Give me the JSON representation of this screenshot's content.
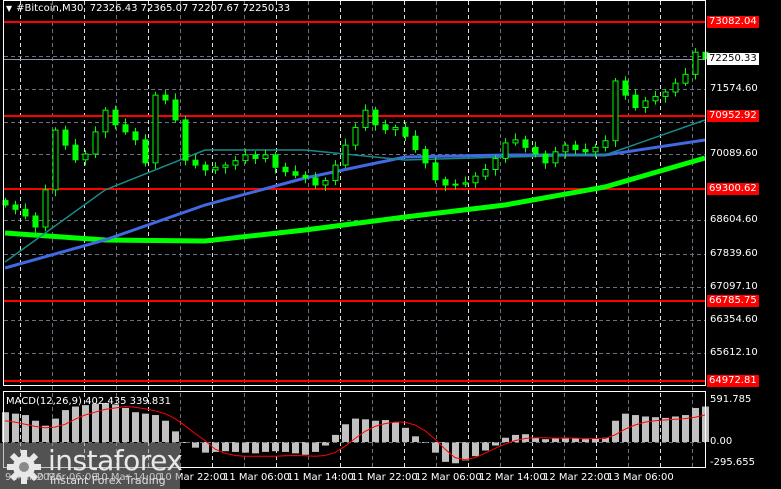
{
  "header": {
    "symbol": "#Bitcoin,M30",
    "open": "72326.43",
    "high": "72365.07",
    "low": "72207.67",
    "close": "72250.33"
  },
  "macd_label": "MACD(12,26,9) 402.435 339.831",
  "watermark": {
    "name": "instaforex",
    "tagline": "Instant Forex Trading"
  },
  "price_axis": {
    "grid_labels": [
      "71574.60",
      "70089.60",
      "68604.60",
      "67839.60",
      "67097.10",
      "66354.60",
      "65612.10"
    ],
    "levels": [
      {
        "label": "73082.04",
        "value": 73082.04
      },
      {
        "label": "70952.92",
        "value": 70952.92
      },
      {
        "label": "69300.62",
        "value": 69300.62
      },
      {
        "label": "66785.75",
        "value": 66785.75
      },
      {
        "label": "64972.81",
        "value": 64972.81
      }
    ],
    "current": {
      "label": "72250.33",
      "value": 72250.33
    }
  },
  "macd_axis": [
    "591.785",
    "0.00",
    "-295.655"
  ],
  "time_axis": [
    "9 Mar 2026",
    "10 Mar 06:00",
    "10 Mar 14:00",
    "10 Mar 22:00",
    "11 Mar 06:00",
    "11 Mar 14:00",
    "11 Mar 22:00",
    "12 Mar 06:00",
    "12 Mar 14:00",
    "12 Mar 22:00",
    "13 Mar 06:00"
  ],
  "colors": {
    "candle": "#00ff00",
    "level": "#ff0000",
    "ma_fast": "#1a8a8a",
    "ma_mid": "#4169e1",
    "ma_slow": "#00ff00",
    "macd_hist": "#c0c0c0",
    "macd_signal": "#ff0000"
  },
  "chart_data": {
    "type": "candlestick",
    "title": "#Bitcoin,M30",
    "ylim": [
      64869.6,
      73300
    ],
    "closes": [
      68948,
      68850,
      68700,
      68450,
      69290,
      70640,
      70300,
      69970,
      70100,
      70600,
      71090,
      70760,
      70600,
      70420,
      69900,
      71430,
      71320,
      70870,
      69960,
      69850,
      69740,
      69800,
      69850,
      69950,
      70080,
      70000,
      70080,
      69800,
      69700,
      69620,
      69560,
      69400,
      69500,
      69850,
      70300,
      70700,
      71090,
      70760,
      70650,
      70700,
      70500,
      70200,
      69900,
      69520,
      69400,
      69420,
      69450,
      69600,
      69750,
      70000,
      70350,
      70420,
      70250,
      70100,
      69900,
      70150,
      70300,
      70200,
      70150,
      70250,
      70400,
      71750,
      71430,
      71150,
      71300,
      71400,
      71500,
      71700,
      71900,
      72400,
      72250
    ],
    "ma_every_10": {
      "fast": [
        67660,
        69287,
        70190,
        70190,
        69965,
        70032,
        70078,
        70868
      ],
      "mid": [
        67525,
        68158,
        68948,
        69558,
        70032,
        70078,
        70078,
        70416
      ],
      "slow": [
        68316,
        68158,
        68135,
        68384,
        68677,
        68948,
        69355,
        70010
      ]
    },
    "macd": {
      "ylim": [
        -295.655,
        591.785
      ],
      "histogram": [
        420,
        400,
        380,
        300,
        230,
        330,
        450,
        500,
        520,
        540,
        550,
        530,
        480,
        420,
        400,
        380,
        300,
        150,
        0,
        -80,
        -150,
        -140,
        -130,
        -140,
        -150,
        -160,
        -140,
        -130,
        -140,
        -160,
        -180,
        -140,
        -50,
        100,
        250,
        330,
        320,
        300,
        310,
        280,
        200,
        80,
        0,
        -150,
        -280,
        -300,
        -260,
        -200,
        -120,
        -50,
        60,
        100,
        110,
        60,
        40,
        50,
        60,
        50,
        40,
        50,
        60,
        300,
        400,
        380,
        360,
        350,
        340,
        360,
        380,
        480,
        500
      ],
      "signal": [
        300,
        280,
        250,
        220,
        200,
        210,
        250,
        320,
        380,
        420,
        460,
        480,
        500,
        490,
        470,
        440,
        400,
        330,
        230,
        120,
        20,
        -100,
        -160,
        -190,
        -200,
        -200,
        -200,
        -200,
        -195,
        -190,
        -195,
        -200,
        -190,
        -150,
        -60,
        50,
        150,
        220,
        260,
        280,
        280,
        240,
        160,
        40,
        -100,
        -220,
        -250,
        -220,
        -160,
        -90,
        -30,
        20,
        50,
        60,
        60,
        55,
        55,
        55,
        50,
        50,
        50,
        100,
        180,
        240,
        280,
        300,
        310,
        320,
        330,
        350,
        380
      ]
    }
  }
}
